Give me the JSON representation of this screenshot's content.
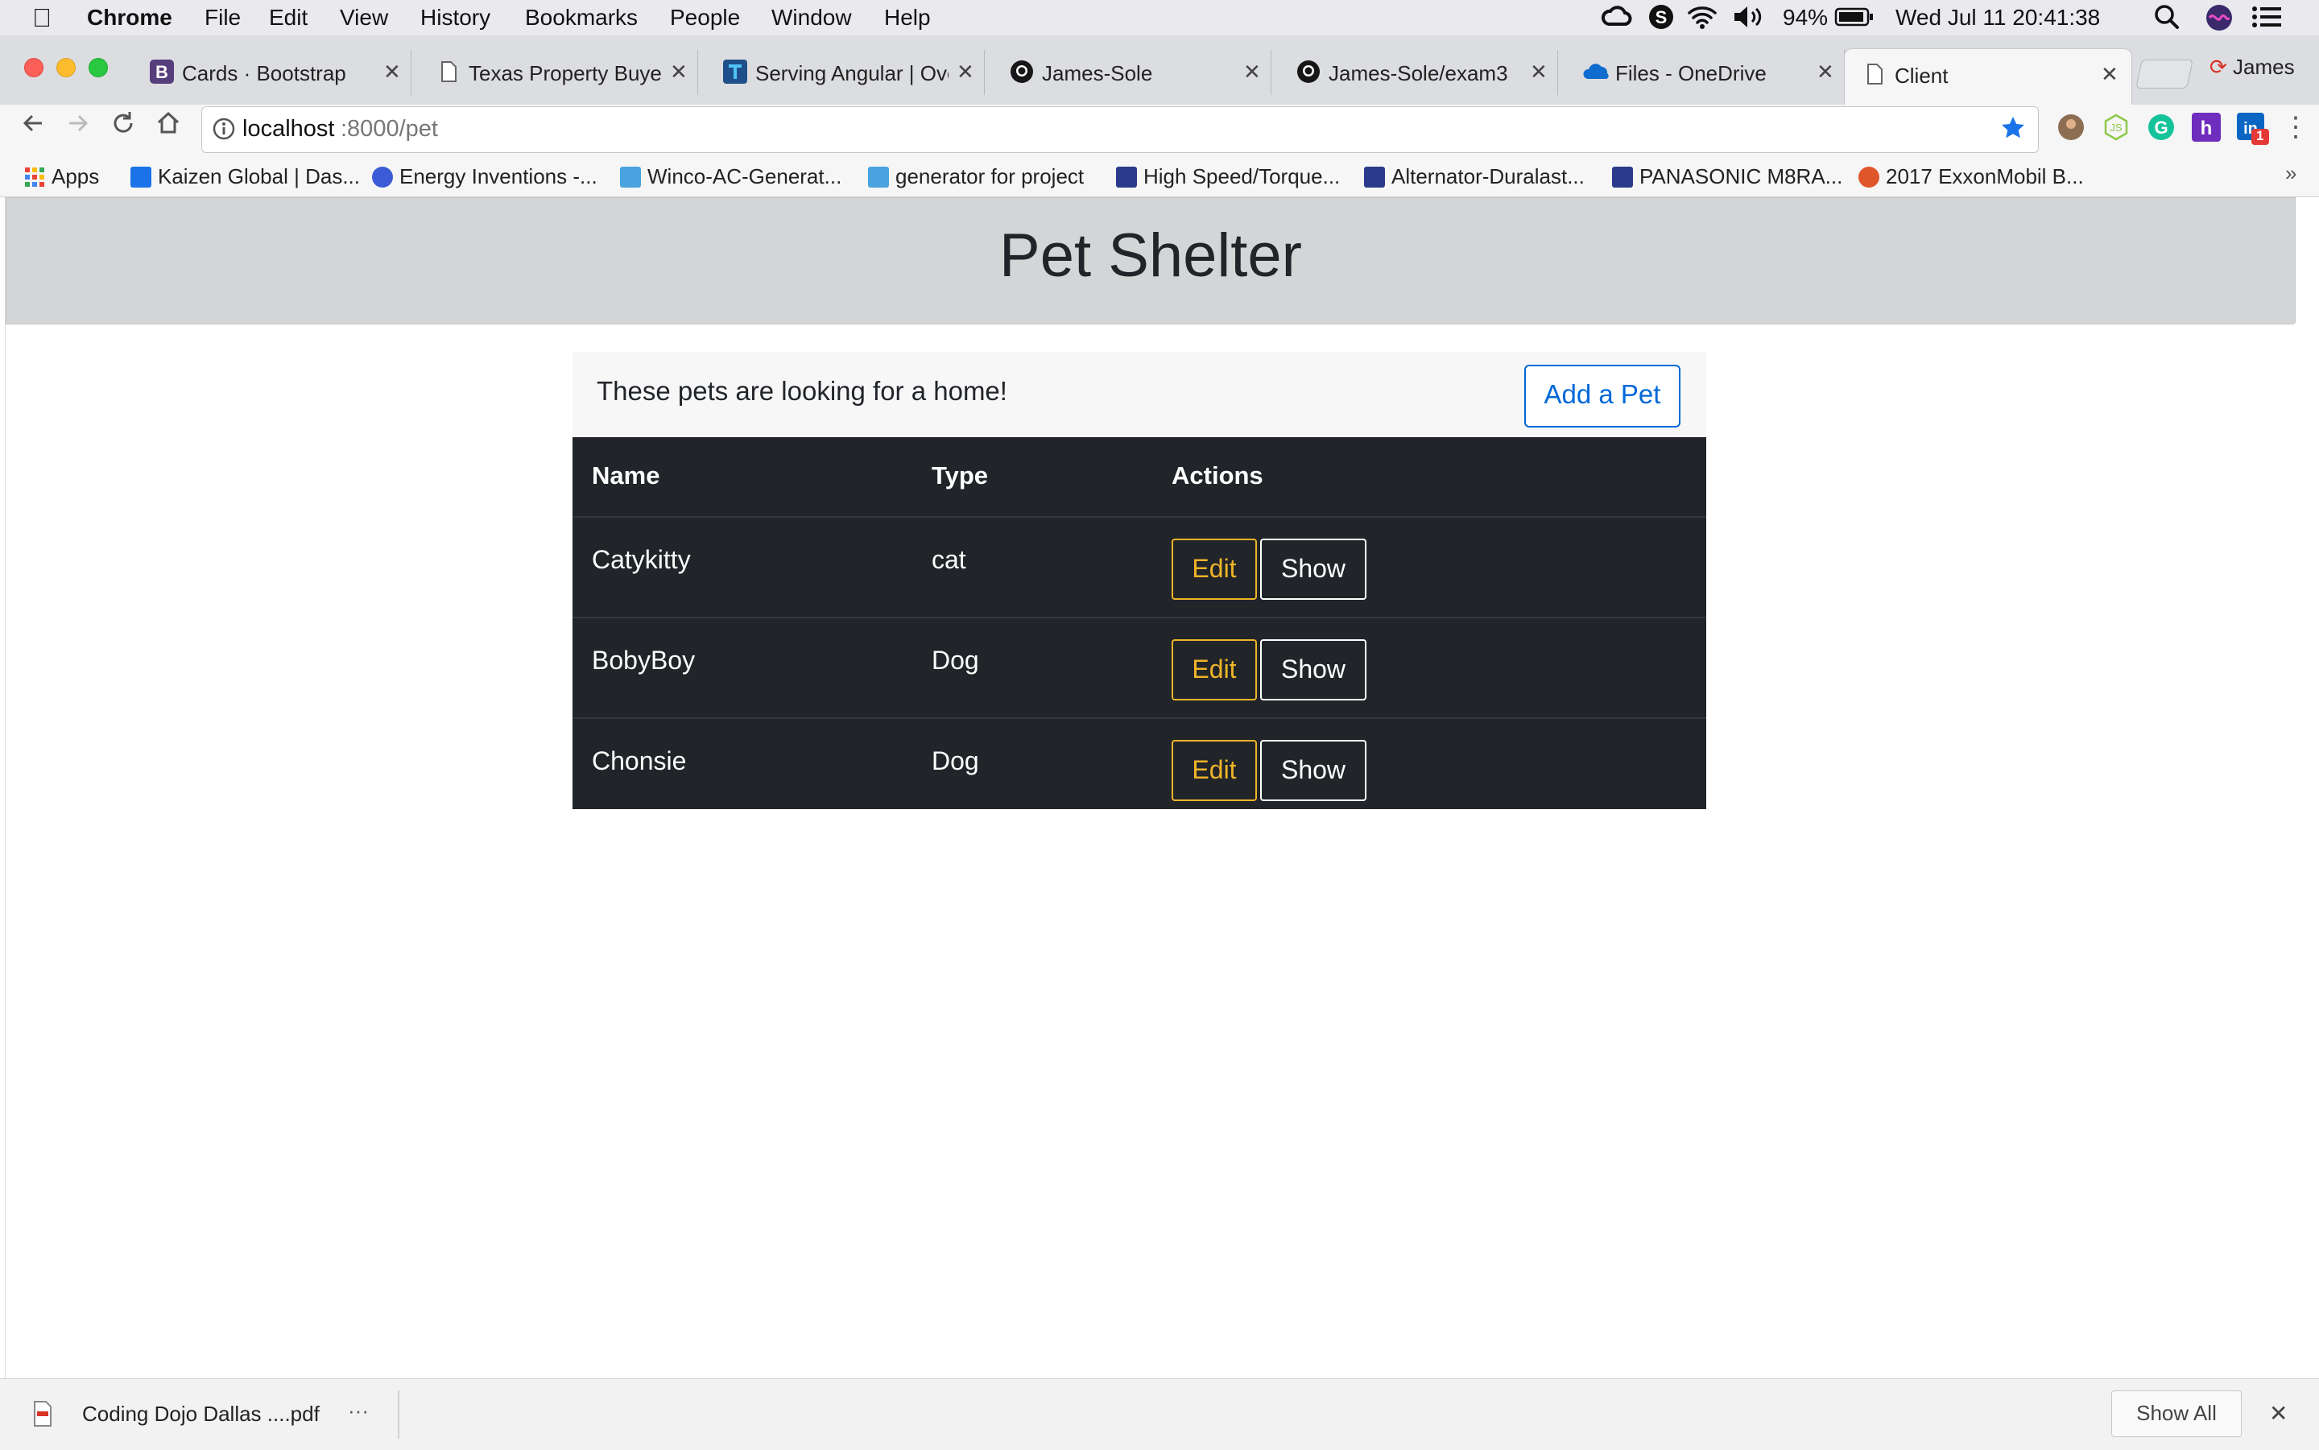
{
  "menubar": {
    "app": "Chrome",
    "items": [
      "File",
      "Edit",
      "View",
      "History",
      "Bookmarks",
      "People",
      "Window",
      "Help"
    ],
    "battery": "94%",
    "datetime": "Wed Jul 11  20:41:38"
  },
  "tabs": [
    {
      "title": "Cards · Bootstrap",
      "icon": "bootstrap-icon"
    },
    {
      "title": "Texas Property Buyer",
      "icon": "page-icon"
    },
    {
      "title": "Serving Angular | Ove",
      "icon": "firebase-icon"
    },
    {
      "title": "James-Sole",
      "icon": "github-icon"
    },
    {
      "title": "James-Sole/exam3",
      "icon": "github-icon"
    },
    {
      "title": "Files - OneDrive",
      "icon": "onedrive-icon"
    },
    {
      "title": "Client",
      "icon": "page-icon",
      "active": true
    }
  ],
  "profile_name": "James",
  "omnibox": {
    "host": "localhost",
    "path": ":8000/pet"
  },
  "extensions": {
    "linkedin_badge": "1"
  },
  "bookmarks": [
    {
      "label": "Apps",
      "color": "#ea4335"
    },
    {
      "label": "Kaizen Global | Das...",
      "color": "#1a73e8"
    },
    {
      "label": "Energy Inventions -...",
      "color": "#3c5bd6"
    },
    {
      "label": "Winco-AC-Generat...",
      "color": "#4aa3df"
    },
    {
      "label": "generator for project",
      "color": "#4aa3df"
    },
    {
      "label": "High Speed/Torque...",
      "color": "#2b3a8c"
    },
    {
      "label": "Alternator-Duralast...",
      "color": "#2b3a8c"
    },
    {
      "label": "PANASONIC M8RA...",
      "color": "#2b3a8c"
    },
    {
      "label": "2017 ExxonMobil B...",
      "color": "#e0562b"
    }
  ],
  "page": {
    "title": "Pet Shelter",
    "lead": "These pets are looking for a home!",
    "add_button": "Add a Pet",
    "table": {
      "headers": [
        "Name",
        "Type",
        "Actions"
      ],
      "rows": [
        {
          "name": "Catykitty",
          "type": "cat",
          "edit": "Edit",
          "show": "Show"
        },
        {
          "name": "BobyBoy",
          "type": "Dog",
          "edit": "Edit",
          "show": "Show"
        },
        {
          "name": "Chonsie",
          "type": "Dog",
          "edit": "Edit",
          "show": "Show"
        }
      ]
    }
  },
  "download_shelf": {
    "file": "Coding Dojo Dallas ....pdf",
    "more": "···",
    "show_all": "Show All",
    "close": "✕"
  },
  "colors": {
    "primary": "#0069d9",
    "warning": "#f0b429",
    "table_dark": "#212529",
    "jumbotron": "#d4d5d7"
  }
}
